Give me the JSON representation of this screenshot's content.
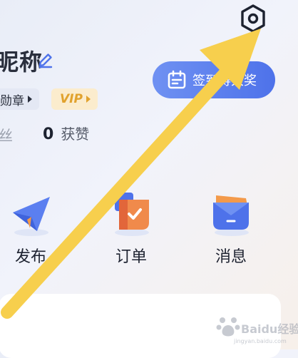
{
  "profile": {
    "nickname": "昵称",
    "medal_badge": "勋章",
    "vip_badge": "VIP",
    "fans_label": "丝",
    "likes_count": "0",
    "likes_label": "获赞"
  },
  "signin": {
    "label": "签到得大奖"
  },
  "quick_actions": [
    {
      "label": "发布",
      "icon": "paper-plane-icon"
    },
    {
      "label": "订单",
      "icon": "order-icon"
    },
    {
      "label": "消息",
      "icon": "message-icon"
    }
  ],
  "watermark": {
    "text": "Baidu经验",
    "url": "jingyan.baidu.com"
  },
  "colors": {
    "accent_blue": "#4e72ea",
    "vip_gold": "#e1a22d",
    "annotation_arrow": "#f7cf4d"
  }
}
